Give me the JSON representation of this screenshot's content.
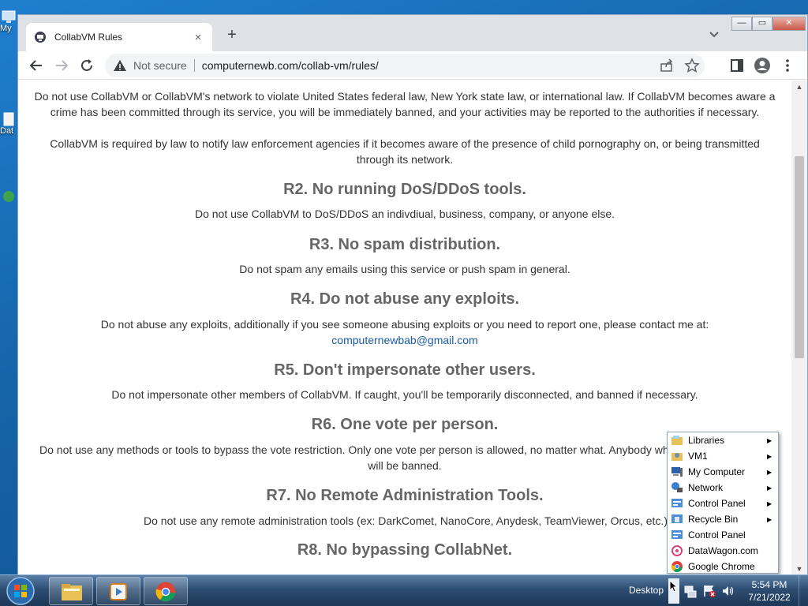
{
  "desktop": {
    "icons": [
      {
        "label": "My"
      },
      {
        "label": "Dat"
      }
    ]
  },
  "browser": {
    "tab": {
      "title": "CollabVM Rules",
      "close": "×"
    },
    "new_tab": "+",
    "window_controls": {
      "minimize": "—",
      "restore": "▭",
      "close": "✕"
    },
    "address_bar": {
      "security": "Not secure",
      "url": "computernewb.com/collab-vm/rules/"
    }
  },
  "page": {
    "intro_paragraphs": [
      "Do not use CollabVM or CollabVM's network to violate United States federal law, New York state law, or international law. If CollabVM becomes aware a crime has been committed through its service, you will be immediately banned, and your activities may be reported to the authorities if necessary.",
      "CollabVM is required by law to notify law enforcement agencies if it becomes aware of the presence of child pornography on, or being transmitted through its network."
    ],
    "rules": [
      {
        "title": "R2. No running DoS/DDoS tools.",
        "body": "Do not use CollabVM to DoS/DDoS an indivdiual, business, company, or anyone else."
      },
      {
        "title": "R3. No spam distribution.",
        "body": "Do not spam any emails using this service or push spam in general."
      },
      {
        "title": "R4. Do not abuse any exploits.",
        "body": "Do not abuse any exploits, additionally if you see someone abusing exploits or you need to report one, please contact me at:",
        "email": "computernewbab@gmail.com"
      },
      {
        "title": "R5. Don't impersonate other users.",
        "body": "Do not impersonate other members of CollabVM. If caught, you'll be temporarily disconnected, and banned if necessary."
      },
      {
        "title": "R6. One vote per person.",
        "body": "Do not use any methods or tools to bypass the vote restriction. Only one vote per person is allowed, no matter what. Anybody wh",
        "body2": "will be banned."
      },
      {
        "title": "R7. No Remote Administration Tools.",
        "body": "Do not use any remote administration tools (ex: DarkComet, NanoCore, Anydesk, TeamViewer, Orcus, etc.)"
      },
      {
        "title": "R8. No bypassing CollabNet."
      }
    ]
  },
  "popup_menu": {
    "items": [
      {
        "label": "Libraries",
        "icon": "libraries-icon",
        "submenu": true
      },
      {
        "label": "VM1",
        "icon": "user-folder-icon",
        "submenu": true
      },
      {
        "label": "My Computer",
        "icon": "computer-icon",
        "submenu": true
      },
      {
        "label": "Network",
        "icon": "network-icon",
        "submenu": true
      },
      {
        "label": "Control Panel",
        "icon": "control-panel-icon",
        "submenu": true
      },
      {
        "label": "Recycle Bin",
        "icon": "recycle-bin-icon",
        "submenu": true
      },
      {
        "label": "Control Panel",
        "icon": "control-panel-icon",
        "submenu": false
      },
      {
        "label": "DataWagon.com",
        "icon": "datawagon-icon",
        "submenu": false
      },
      {
        "label": "Google Chrome",
        "icon": "chrome-icon",
        "submenu": false
      }
    ],
    "arrow": "▶"
  },
  "taskbar": {
    "desktop_label": "Desktop",
    "time": "5:54 PM",
    "date": "7/21/2022"
  },
  "colors": {
    "heading": "#666666",
    "link": "#1a5aa6",
    "taskbar": "#2d4d72"
  }
}
